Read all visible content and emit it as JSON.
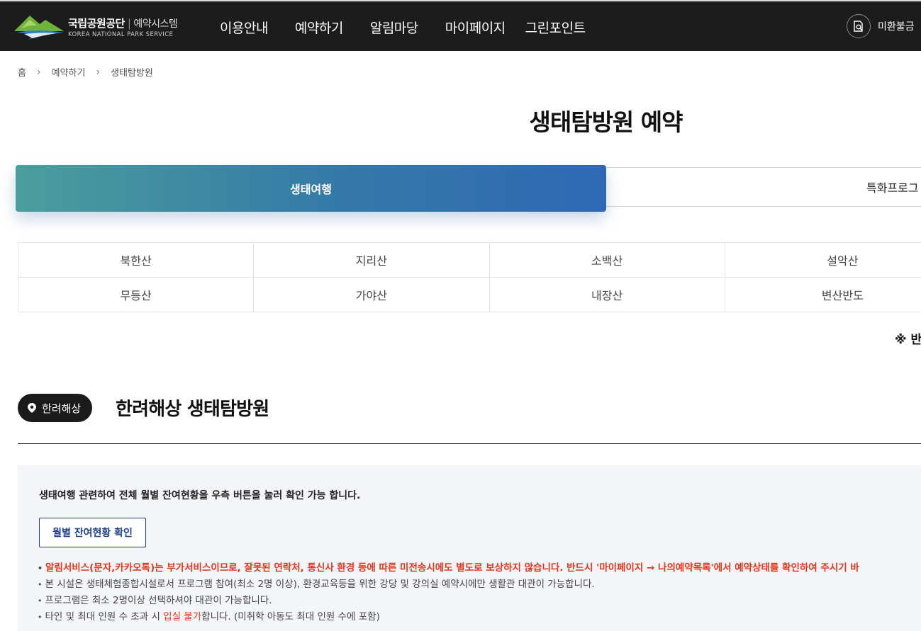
{
  "header": {
    "logo_kr": "국립공원공단",
    "logo_sep": "|",
    "logo_sys": "예약시스템",
    "logo_en": "KOREA NATIONAL PARK SERVICE",
    "nav": [
      "이용안내",
      "예약하기",
      "알림마당",
      "마이페이지",
      "그린포인트"
    ],
    "refund_label": "미환불금"
  },
  "breadcrumb": [
    "홈",
    "예약하기",
    "생태탐방원"
  ],
  "page_title": "생태탐방원 예약",
  "tabs": {
    "active": "생태여행",
    "other": "특화프로그"
  },
  "parks": [
    [
      "북한산",
      "지리산",
      "소백산",
      "설악산"
    ],
    [
      "무등산",
      "가야산",
      "내장산",
      "변산반도"
    ]
  ],
  "right_notice": "※ 반",
  "section": {
    "badge": "한려해상",
    "title": "한려해상 생태탐방원"
  },
  "info": {
    "intro": "생태여행 관련하여 전체 월별 잔여현황을 우측 버튼을 눌러 확인 가능 합니다.",
    "button": "월별 잔여현황 확인",
    "alert": "알림서비스(문자,카카오톡)는 부가서비스이므로, 잘못된 연락처, 통신사 환경 등에 따른 미전송시에도 별도로 보상하지 않습니다. 반드시 '마이페이지 → 나의예약목록'에서 예약상태를 확인하여 주시기 바",
    "note1": "본 시설은 생태체험종합시설로서 프로그램 참여(최소 2명 이상), 환경교육등을 위한 강당 및 강의실 예약시에만 생활관 대관이 가능합니다.",
    "note2": "프로그램은 최소 2명이상 선택하셔야 대관이 가능합니다.",
    "note3_pre": "타인 및 최대 인원 수 초과 시 ",
    "note3_red": "입실 불가",
    "note3_post": "합니다. (미취학 아동도 최대 인원 수에 포함)"
  },
  "colors": {
    "header_bg": "#1c1c1c",
    "tab_gradient_start": "#4a9e9d",
    "tab_gradient_end": "#2f68b5",
    "alert_red": "#e2361b",
    "button_navy": "#1f3f8a"
  }
}
